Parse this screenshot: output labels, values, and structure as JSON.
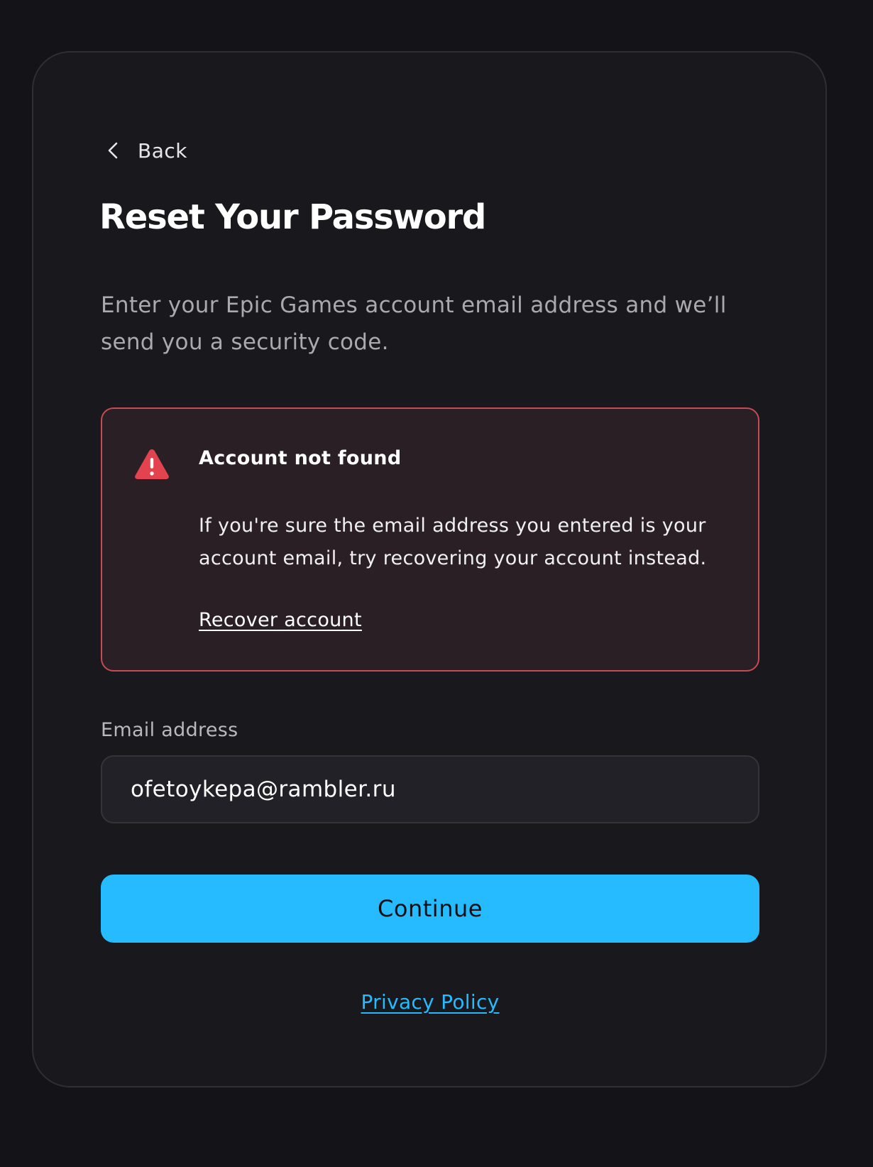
{
  "back": {
    "label": "Back",
    "icon": "chevron-left-icon"
  },
  "page": {
    "title": "Reset Your Password",
    "subtitle": "Enter your Epic Games account email address and we’ll send you a security code."
  },
  "alert": {
    "icon": "warning-triangle-icon",
    "title": "Account not found",
    "body": "If you're sure the email address you entered is your account email, try recovering your account instead.",
    "link": "Recover account"
  },
  "email_field": {
    "label": "Email address",
    "value": "ofetoykepa@rambler.ru"
  },
  "actions": {
    "continue_label": "Continue"
  },
  "footer": {
    "privacy_label": "Privacy Policy"
  },
  "colors": {
    "background": "#131318",
    "card": "#18181d",
    "accent": "#26bbff",
    "error": "#e2434f",
    "error_background": "#2a1f24"
  }
}
